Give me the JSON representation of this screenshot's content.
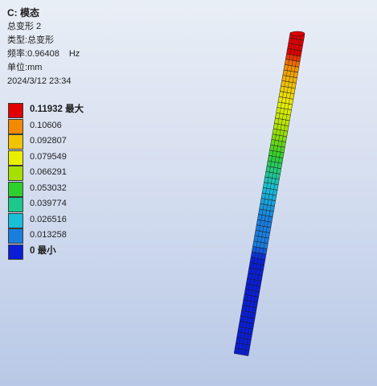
{
  "header": {
    "title": "C: 模态",
    "result_name": "总变形 2",
    "type_label": "类型:",
    "type_value": "总变形",
    "freq_label": "频率:",
    "freq_value": "0.96408",
    "freq_unit": "Hz",
    "unit_label": "单位:",
    "unit_value": "mm",
    "timestamp": "2024/3/12 23:34"
  },
  "legend": {
    "entries": [
      {
        "value": "0.11932",
        "suffix": "最大",
        "color": "#e00000",
        "bold": true
      },
      {
        "value": "0.10606",
        "suffix": "",
        "color": "#f28a00",
        "bold": false
      },
      {
        "value": "0.092807",
        "suffix": "",
        "color": "#f2c400",
        "bold": false
      },
      {
        "value": "0.079549",
        "suffix": "",
        "color": "#e9ef00",
        "bold": false
      },
      {
        "value": "0.066291",
        "suffix": "",
        "color": "#a6e000",
        "bold": false
      },
      {
        "value": "0.053032",
        "suffix": "",
        "color": "#2ed02e",
        "bold": false
      },
      {
        "value": "0.039774",
        "suffix": "",
        "color": "#1ec78c",
        "bold": false
      },
      {
        "value": "0.026516",
        "suffix": "",
        "color": "#18bfd6",
        "bold": false
      },
      {
        "value": "0.013258",
        "suffix": "",
        "color": "#1a7ee0",
        "bold": false
      },
      {
        "value": "0",
        "suffix": "最小",
        "color": "#0a1ed8",
        "bold": true
      }
    ]
  },
  "model": {
    "description_icon": "beam-mesh",
    "colors": {
      "min": "#0a1ed8",
      "low": "#1a7ee0",
      "mid_low": "#18bfd6",
      "mid": "#2ed02e",
      "mid_high": "#a6e000",
      "high_mid": "#e9ef00",
      "high": "#f2c400",
      "higher": "#f28a00",
      "max": "#e00000",
      "mesh_line": "#1a1a1a"
    }
  }
}
